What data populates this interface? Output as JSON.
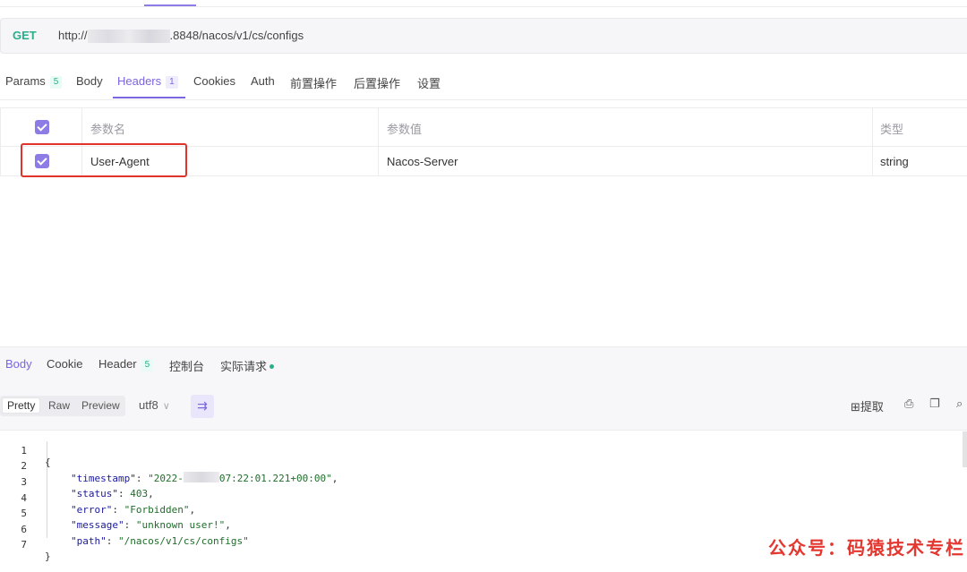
{
  "request": {
    "method": "GET",
    "url_prefix": "http://",
    "url_suffix": ".8848/nacos/v1/cs/configs"
  },
  "request_tabs": [
    {
      "label": "Params",
      "badge": "5"
    },
    {
      "label": "Body"
    },
    {
      "label": "Headers",
      "badge": "1",
      "active": true
    },
    {
      "label": "Cookies"
    },
    {
      "label": "Auth"
    },
    {
      "label": "前置操作"
    },
    {
      "label": "后置操作"
    },
    {
      "label": "设置"
    }
  ],
  "headers_table": {
    "columns": [
      "参数名",
      "参数值",
      "类型"
    ],
    "rows": [
      {
        "checked": true,
        "name": "User-Agent",
        "value": "Nacos-Server",
        "type": "string"
      }
    ]
  },
  "response_tabs": [
    {
      "label": "Body",
      "active": true
    },
    {
      "label": "Cookie"
    },
    {
      "label": "Header",
      "badge": "5"
    },
    {
      "label": "控制台"
    },
    {
      "label": "实际请求",
      "dot": true
    }
  ],
  "response_toolbar": {
    "view_modes": [
      "Pretty",
      "Raw",
      "Preview"
    ],
    "active_view": "Pretty",
    "encoding": "utf8",
    "extract_label": "提取",
    "icons": [
      "wrap-lines-icon",
      "extract-icon",
      "save-icon",
      "copy-icon",
      "search-icon"
    ]
  },
  "response_body": {
    "line_numbers": [
      "1",
      "2",
      "3",
      "4",
      "5",
      "6",
      "7"
    ],
    "timestamp_prefix": "2022-",
    "timestamp_suffix": "07:22:01.221+00:00",
    "status": "403",
    "error": "Forbidden",
    "message": "unknown user!",
    "path": "/nacos/v1/cs/configs"
  },
  "watermark": "公众号：码猿技术专栏",
  "colors": {
    "accent": "#7b65e0",
    "method": "#27b08b",
    "highlight_box": "#e0332c"
  }
}
